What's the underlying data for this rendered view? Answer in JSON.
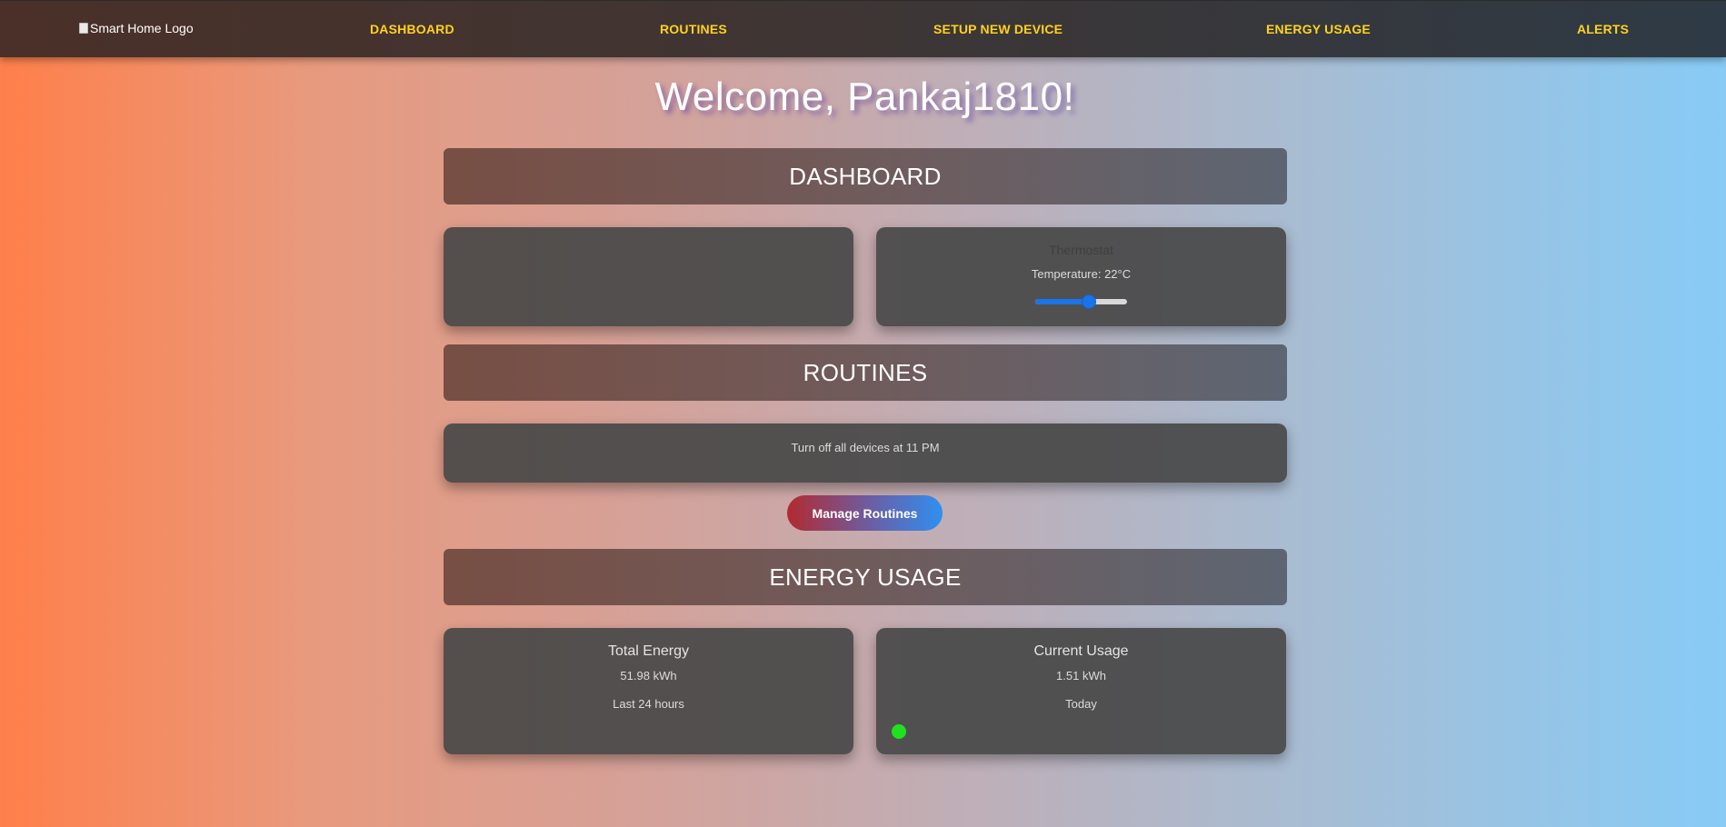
{
  "nav": {
    "logo_alt": "Smart Home Logo",
    "links": [
      "DASHBOARD",
      "ROUTINES",
      "SETUP NEW DEVICE",
      "ENERGY USAGE",
      "ALERTS"
    ]
  },
  "welcome": "Welcome, Pankaj1810!",
  "sections": {
    "dashboard": "DASHBOARD",
    "routines": "ROUTINES",
    "energy": "ENERGY USAGE"
  },
  "thermostat": {
    "title": "Thermostat",
    "temperature_text": "Temperature: 22°C",
    "slider_level": 0.6
  },
  "routines": {
    "item": "Turn off all devices at 11 PM",
    "manage_label": "Manage Routines"
  },
  "energy": {
    "total": {
      "title": "Total Energy",
      "value": "51.98 kWh",
      "period": "Last 24 hours"
    },
    "current": {
      "title": "Current Usage",
      "value": "1.51 kWh",
      "period": "Today",
      "status_color": "#1ee21e"
    }
  },
  "colors": {
    "nav_link": "#ffd21e",
    "accent_blue": "#1a73e8"
  }
}
